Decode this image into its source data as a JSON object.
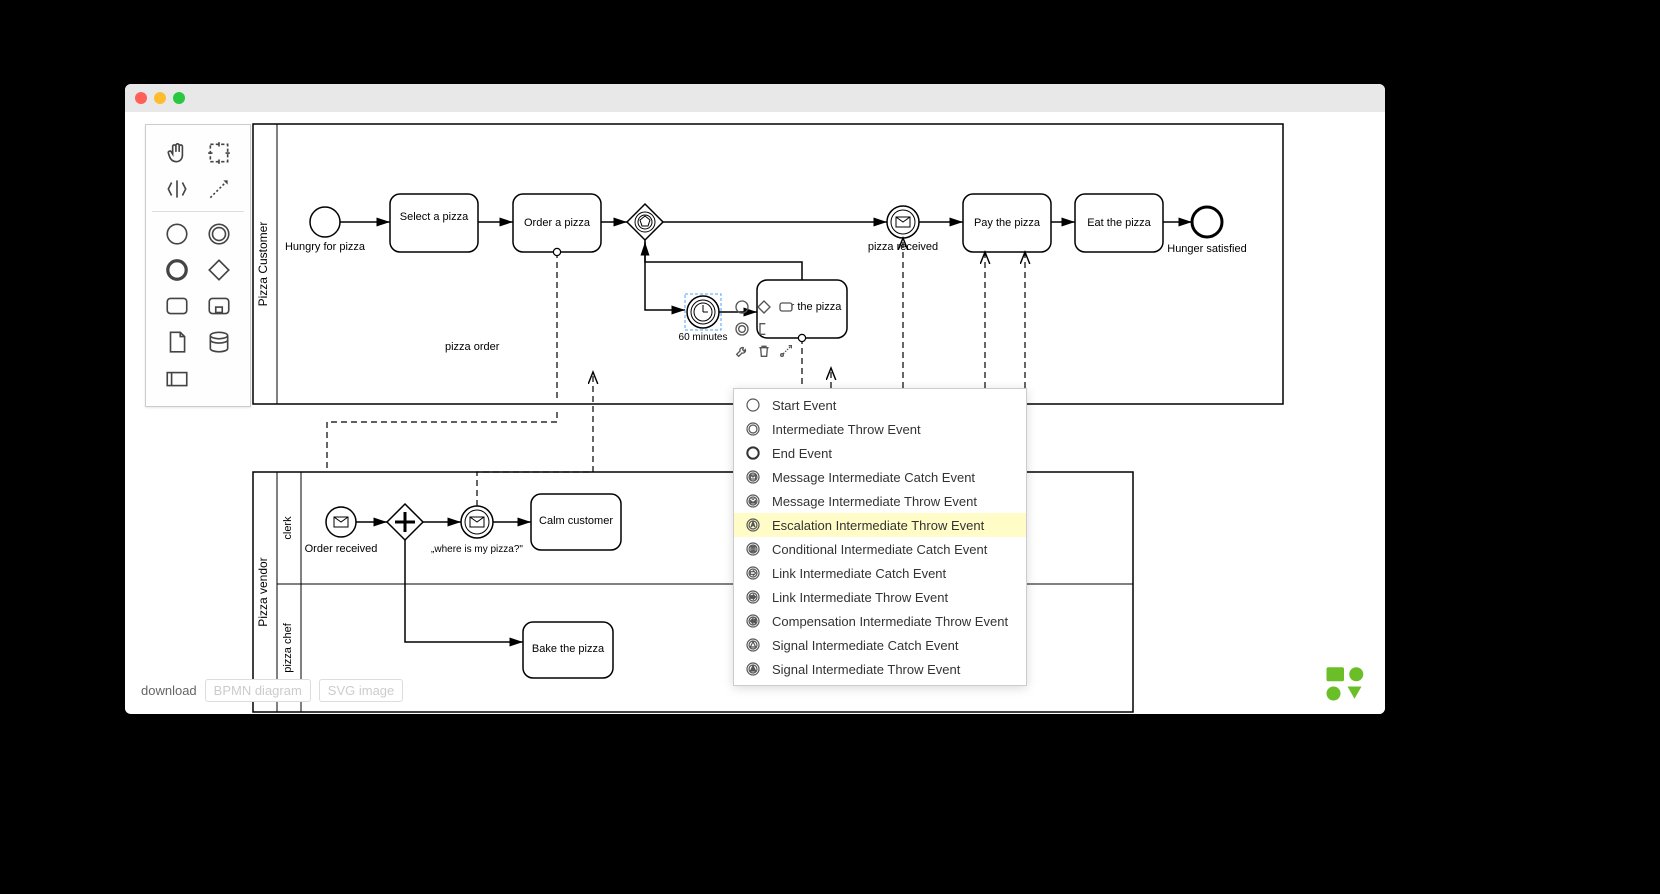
{
  "pools": {
    "customer_lane": "Pizza Customer",
    "vendor_pool": "Pizza vendor",
    "vendor_lane_clerk": "clerk",
    "vendor_lane_chef": "pizza chef"
  },
  "tasks": {
    "select_pizza": "Select a pizza",
    "order_pizza": "Order a pizza",
    "ask_pizza": "r the pizza",
    "pay_pizza": "Pay the pizza",
    "eat_pizza": "Eat the pizza",
    "calm_customer": "Calm customer",
    "bake_pizza": "Bake the pizza"
  },
  "events": {
    "hungry": "Hungry for pizza",
    "pizza_received": "pizza received",
    "hunger_satisfied": "Hunger satisfied",
    "sixty_minutes": "60 minutes",
    "order_received": "Order received",
    "where_is_pizza": "„where is my pizza?\""
  },
  "flows": {
    "pizza_order": "pizza order"
  },
  "download": {
    "label": "download",
    "bpmn": "BPMN diagram",
    "svg": "SVG image"
  },
  "context_menu": {
    "items": [
      {
        "label": "Start Event",
        "icon": "start",
        "hl": false
      },
      {
        "label": "Intermediate Throw Event",
        "icon": "inter-throw",
        "hl": false
      },
      {
        "label": "End Event",
        "icon": "end",
        "hl": false
      },
      {
        "label": "Message Intermediate Catch Event",
        "icon": "msg-catch",
        "hl": false
      },
      {
        "label": "Message Intermediate Throw Event",
        "icon": "msg-throw",
        "hl": false
      },
      {
        "label": "Escalation Intermediate Throw Event",
        "icon": "esc-throw",
        "hl": true
      },
      {
        "label": "Conditional Intermediate Catch Event",
        "icon": "cond-catch",
        "hl": false
      },
      {
        "label": "Link Intermediate Catch Event",
        "icon": "link-catch",
        "hl": false
      },
      {
        "label": "Link Intermediate Throw Event",
        "icon": "link-throw",
        "hl": false
      },
      {
        "label": "Compensation Intermediate Throw Event",
        "icon": "comp-throw",
        "hl": false
      },
      {
        "label": "Signal Intermediate Catch Event",
        "icon": "sig-catch",
        "hl": false
      },
      {
        "label": "Signal Intermediate Throw Event",
        "icon": "sig-throw",
        "hl": false
      }
    ]
  }
}
